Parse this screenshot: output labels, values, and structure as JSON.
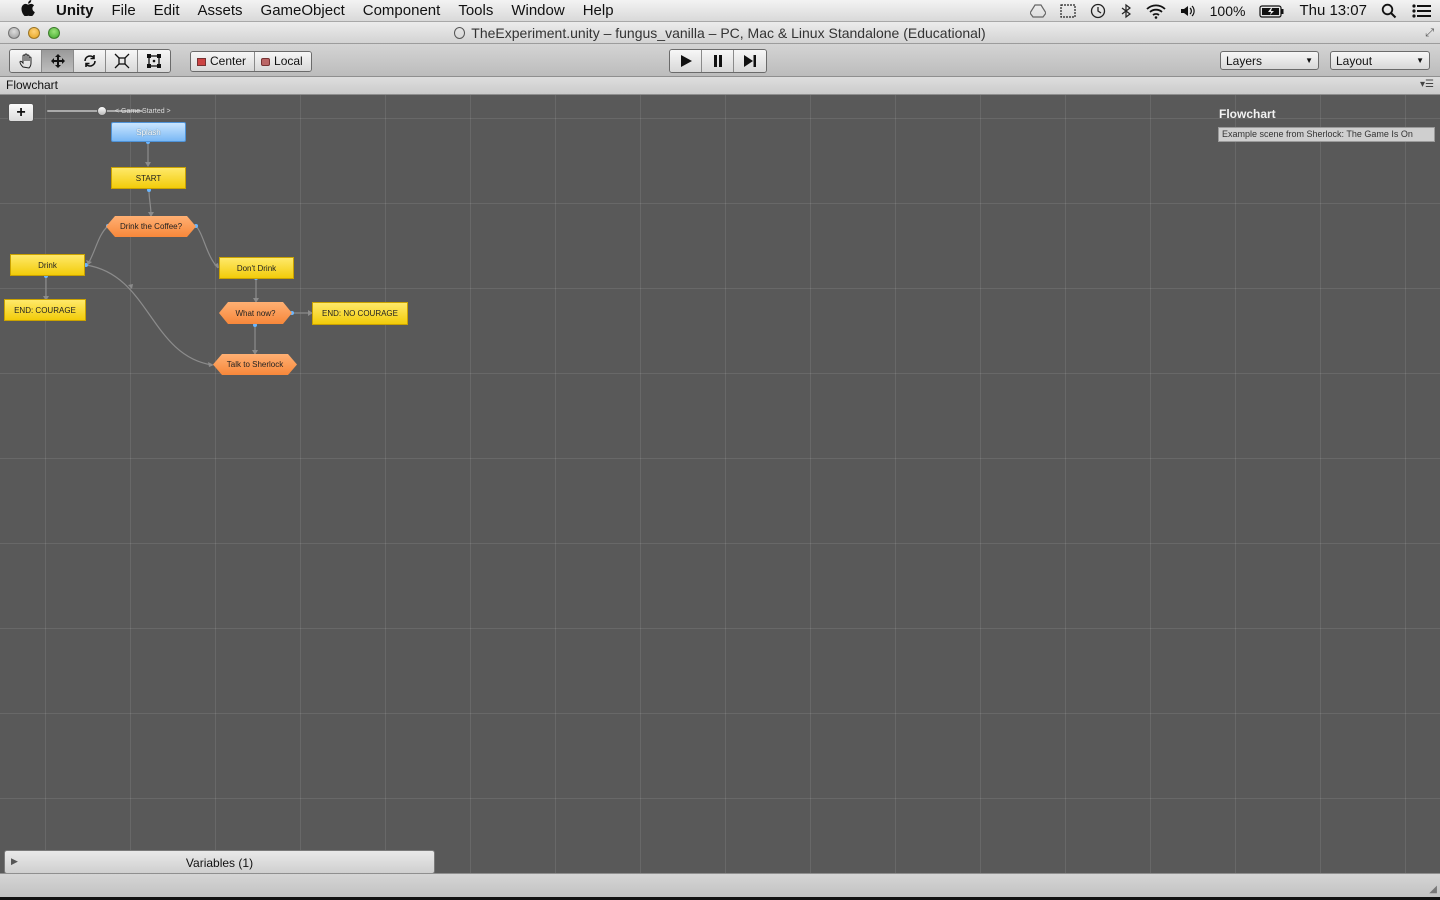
{
  "menubar": {
    "app": "Unity",
    "items": [
      "File",
      "Edit",
      "Assets",
      "GameObject",
      "Component",
      "Tools",
      "Window",
      "Help"
    ],
    "battery": "100%",
    "clock": "Thu 13:07"
  },
  "window": {
    "title": "TheExperiment.unity – fungus_vanilla – PC, Mac & Linux Standalone (Educational)"
  },
  "toolbar": {
    "transform_tools": [
      "hand-icon",
      "move-icon",
      "rotate-icon",
      "scale-icon",
      "rect-icon"
    ],
    "active_tool": "move-icon",
    "pivot_mode": "Center",
    "pivot_rotation": "Local",
    "layers": "Layers",
    "layout": "Layout"
  },
  "panel": {
    "tab": "Flowchart"
  },
  "flowchart": {
    "event_label": "< Game Started >",
    "title": "Flowchart",
    "description": "Example scene from Sherlock: The Game Is On",
    "blocks": {
      "splash": "Splash",
      "start": "START",
      "drink_coffee": "Drink the Coffee?",
      "drink": "Drink",
      "dont_drink": "Don't Drink",
      "end_courage": "END: COURAGE",
      "what_now": "What now?",
      "end_no_courage": "END: NO COURAGE",
      "talk_sherlock": "Talk to Sherlock"
    },
    "variables": "Variables (1)"
  },
  "colors": {
    "event_block": "#7ab8f5",
    "command_block": "#f2cc0a",
    "choice_block": "#f7873a",
    "canvas": "#595959"
  }
}
